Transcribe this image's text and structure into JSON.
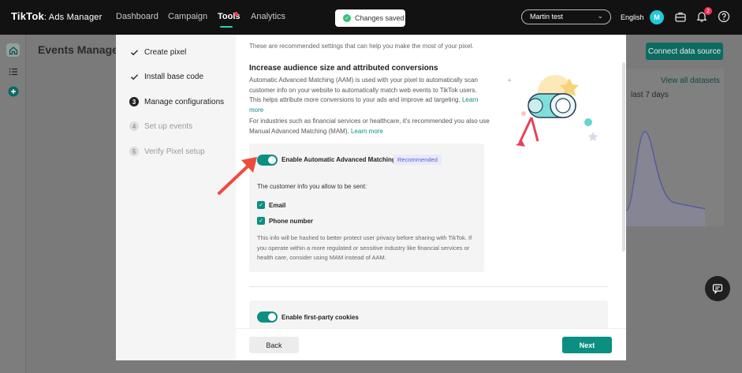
{
  "topbar": {
    "brand": "TikTok",
    "brand_sub": ": Ads Manager",
    "nav": [
      "Dashboard",
      "Campaign",
      "Tools",
      "Analytics"
    ],
    "toast": "Changes saved",
    "account": "Martin test",
    "language": "English",
    "avatar_initial": "M",
    "notification_count": "2"
  },
  "background": {
    "page_title": "Events Manager",
    "connect_button": "Connect data source",
    "view_all": "View all datasets",
    "range_text": "last 7 days"
  },
  "steps": [
    {
      "label": "Create pixel",
      "state": "done"
    },
    {
      "label": "Install base code",
      "state": "done"
    },
    {
      "label": "Manage configurations",
      "state": "active",
      "num": "3"
    },
    {
      "label": "Set up events",
      "state": "todo",
      "num": "4"
    },
    {
      "label": "Verify Pixel setup",
      "state": "todo",
      "num": "5"
    }
  ],
  "content": {
    "intro": "These are recommended settings that can help you make the most of your pixel.",
    "section_title": "Increase audience size and attributed conversions",
    "aam_para": "Automatic Advanced Matching (AAM) is used with your pixel to automatically scan customer info on your website to automatically match web events to TikTok users. This helps attribute more conversions to your ads and improve ad targeting.",
    "learn_more": "Learn more",
    "mam_para": "For industries such as financial services or healthcare, it's recommended you also use Manual Advanced Matching (MAM).",
    "toggle_aam_label": "Enable Automatic Advanced Matching",
    "recommended_badge": "Recommended",
    "customer_info_label": "The customer info you allow to be sent:",
    "checkbox_email": "Email",
    "checkbox_phone": "Phone number",
    "hash_para": "This info will be hashed to better protect user privacy before sharing with TikTok. If you operate within a more regulated or sensitive industry like financial services or health care, consider using MAM instead of AAM.",
    "toggle_cookies_label": "Enable first-party cookies"
  },
  "footer": {
    "back": "Back",
    "next": "Next"
  },
  "colors": {
    "accent": "#0a8f82",
    "topbar": "#121212",
    "badge": "#fe2c55",
    "arrow": "#ef4b3c"
  }
}
